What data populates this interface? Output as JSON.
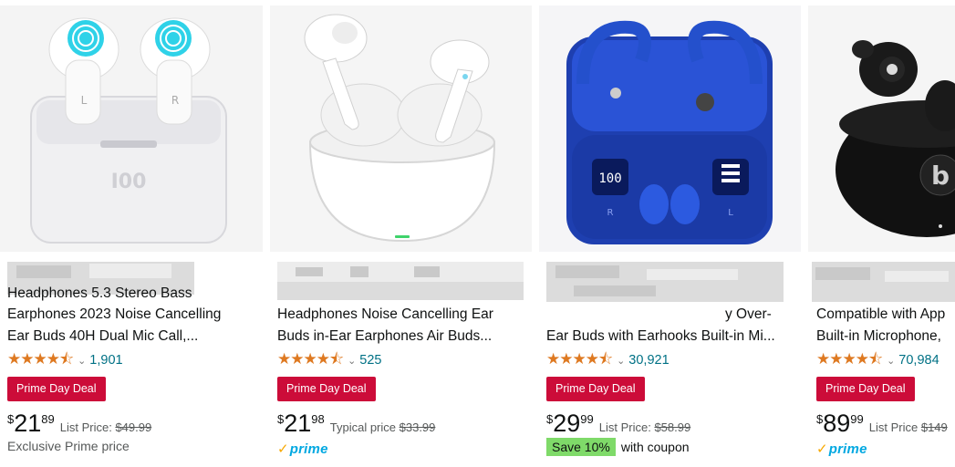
{
  "products": [
    {
      "title_line1": "Headphones 5.3 Stereo Bass",
      "title_line2": "Earphones 2023 Noise Cancelling",
      "title_line3": "Ear Buds 40H Dual Mic Call,...",
      "stars": "★★★★⯪",
      "rating_count": "1,901",
      "deal_badge": "Prime Day Deal",
      "price_symbol": "$",
      "price_whole": "21",
      "price_fraction": "89",
      "list_label": "List Price:",
      "list_price": "$49.99",
      "extra_text": "Exclusive Prime price"
    },
    {
      "title_line1": "Headphones Noise Cancelling Ear",
      "title_line2": "Buds in-Ear Earphones Air Buds...",
      "stars": "★★★★⯪",
      "rating_count": "525",
      "deal_badge": "Prime Day Deal",
      "price_symbol": "$",
      "price_whole": "21",
      "price_fraction": "98",
      "list_label": "Typical price",
      "list_price": "$33.99",
      "prime_label": "prime"
    },
    {
      "title_line1": "y Over-",
      "title_line2": "Ear Buds with Earhooks Built-in Mi...",
      "stars": "★★★★⯪",
      "rating_count": "30,921",
      "deal_badge": "Prime Day Deal",
      "price_symbol": "$",
      "price_whole": "29",
      "price_fraction": "99",
      "list_label": "List Price:",
      "list_price": "$58.99",
      "coupon_badge": "Save 10%",
      "coupon_text": "with coupon"
    },
    {
      "title_line1": "Compatible with App",
      "title_line2": "Built-in Microphone,",
      "stars": "★★★★⯪",
      "rating_count": "70,984",
      "deal_badge": "Prime Day Deal",
      "price_symbol": "$",
      "price_whole": "89",
      "price_fraction": "99",
      "list_label": "List Price",
      "list_price": "$149",
      "prime_label": "prime"
    }
  ],
  "image_text": {
    "p1_logo": "I00",
    "p1_left_bud": "L",
    "p1_right_bud": "R",
    "p3_display_left": "100",
    "p3_left_bud": "R",
    "p3_right_bud": "L",
    "p4_logo": "b"
  }
}
